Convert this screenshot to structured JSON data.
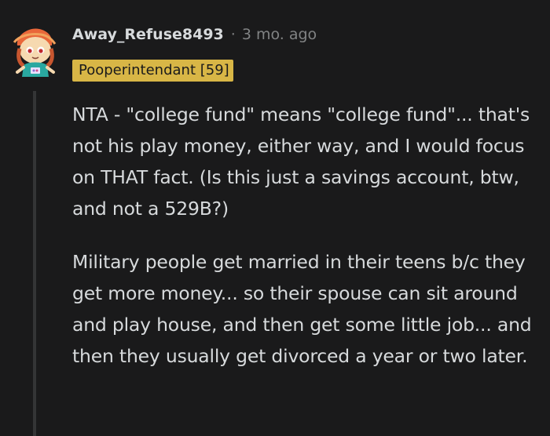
{
  "comment": {
    "author": "Away_Refuse8493",
    "separator": "·",
    "timestamp": "3 mo. ago",
    "flair": "Pooperintendant [59]",
    "paragraphs": [
      "NTA - \"college fund\" means \"college fund\"... that's not his play money, either way, and I would focus on THAT fact. (Is this just a savings account, btw, and not a 529B?)",
      "Military people get married in their teens b/c they get more money... so their spouse can sit around and play house, and then get some little job... and then they usually get divorced a year or two later."
    ]
  },
  "colors": {
    "background": "#1a1a1b",
    "text": "#d7dadc",
    "meta": "#818384",
    "flair_bg": "#d8b646",
    "thread_line": "#343536"
  },
  "icons": {
    "avatar": "snoo-avatar-icon"
  }
}
